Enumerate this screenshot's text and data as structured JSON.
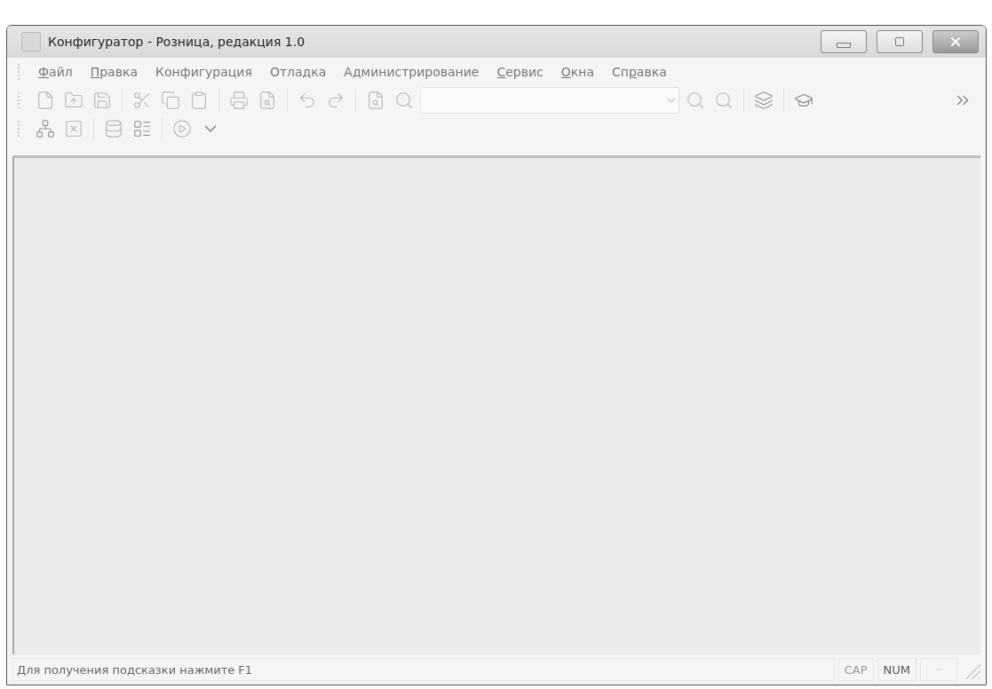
{
  "window": {
    "title": "Конфигуратор - Розница, редакция 1.0"
  },
  "menu": [
    {
      "key": "Ф",
      "post": "айл"
    },
    {
      "key": "П",
      "post": "равка"
    },
    {
      "pre": "Конфигурация"
    },
    {
      "pre": "Отладка"
    },
    {
      "pre": "Администрирование"
    },
    {
      "key": "С",
      "post": "ервис"
    },
    {
      "key": "О",
      "post": "кна"
    },
    {
      "pre": "Сп",
      "key": "р",
      "post": "авка"
    }
  ],
  "status_bar": {
    "message": "Для получения подсказки нажмите F1",
    "indicators": [
      {
        "label": "CAP",
        "on": false
      },
      {
        "label": "NUM",
        "on": true
      }
    ]
  }
}
